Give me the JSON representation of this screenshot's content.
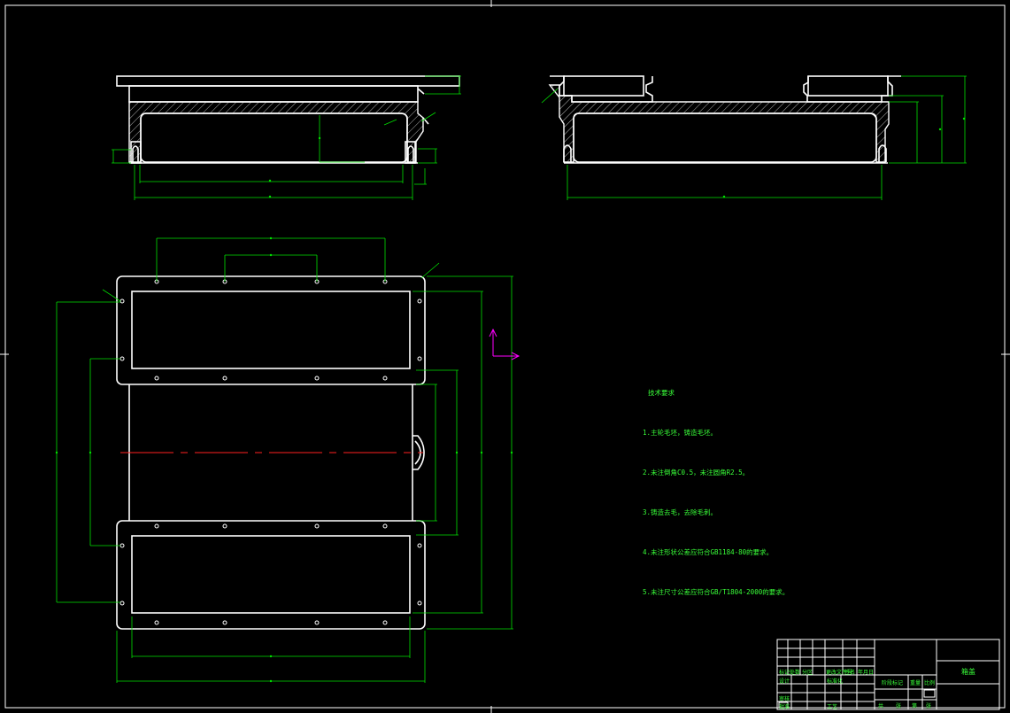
{
  "technical_requirements": {
    "title": "技术要求",
    "items": [
      "1.主轮毛坯，铸造毛坯。",
      "2.未注倒角C0.5，未注圆角R2.5。",
      "3.铸造去毛，去除毛刺。",
      "4.未注形状公差应符合GB1184-80的要求。",
      "5.未注尺寸公差应符合GB/T1804-2000的要求。"
    ]
  },
  "title_block": {
    "part_name": "箱盖",
    "labels": [
      "标记",
      "处数",
      "分区",
      "更改文件号",
      "签名",
      "年月日",
      "设计",
      "标准化",
      "阶段标记",
      "重量",
      "比例",
      "审核",
      "工艺",
      "批准",
      "共",
      "张",
      "第",
      "张"
    ]
  },
  "colors": {
    "background": "#000000",
    "outline": "#ffffff",
    "dimension": "#00e000",
    "centerline": "#ff2020",
    "ucs": "#ff00ff"
  }
}
